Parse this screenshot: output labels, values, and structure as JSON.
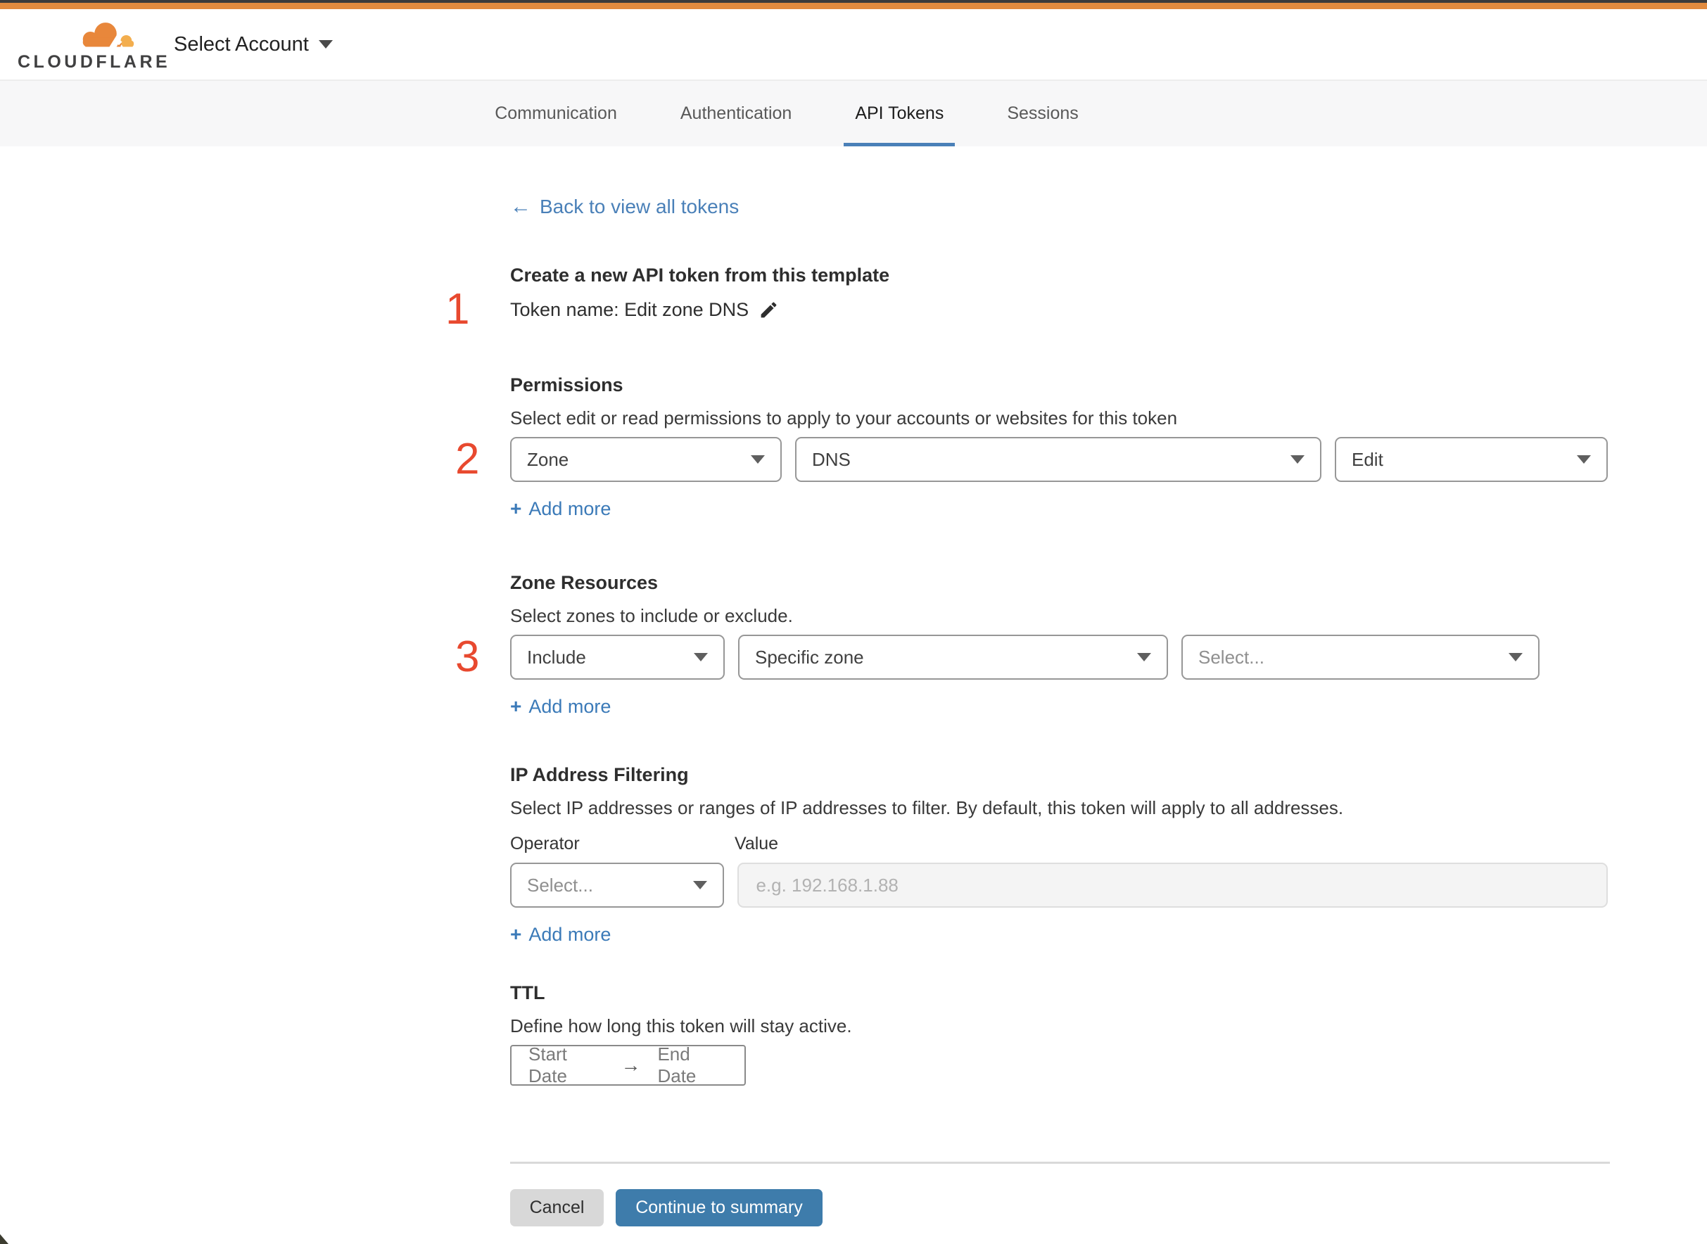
{
  "brand": {
    "logo_text": "CLOUDFLARE",
    "account_selector": "Select Account"
  },
  "tabs": {
    "items": [
      {
        "label": "Communication"
      },
      {
        "label": "Authentication"
      },
      {
        "label": "API Tokens"
      },
      {
        "label": "Sessions"
      }
    ],
    "active": "API Tokens"
  },
  "page": {
    "back_link": {
      "arrow": "←",
      "label": "Back to view all tokens"
    },
    "token": {
      "step": "1",
      "heading": "Create a new API token from this template",
      "name_line": "Token name: Edit zone DNS"
    },
    "permissions": {
      "step": "2",
      "heading": "Permissions",
      "description": "Select edit or read permissions to apply to your accounts or websites for this token",
      "scope_select": "Zone",
      "resource_select": "DNS",
      "access_select": "Edit"
    },
    "zone_resources": {
      "step": "3",
      "heading": "Zone Resources",
      "description": "Select zones to include or exclude.",
      "mode_select": "Include",
      "type_select": "Specific zone",
      "zone_select_placeholder": "Select..."
    },
    "ip_filtering": {
      "heading": "IP Address Filtering",
      "description": "Select IP addresses or ranges of IP addresses to filter. By default, this token will apply to all addresses.",
      "operator_label": "Operator",
      "value_label": "Value",
      "operator_select_placeholder": "Select...",
      "value_placeholder": "e.g. 192.168.1.88"
    },
    "ttl": {
      "heading": "TTL",
      "description": "Define how long this token will stay active.",
      "start_label": "Start Date",
      "arrow": "→",
      "end_label": "End Date"
    },
    "actions": {
      "plus": "+",
      "add_more": "Add more",
      "cancel": "Cancel",
      "continue": "Continue to summary"
    }
  },
  "colors": {
    "top_bar_orange": "#e18b3f",
    "top_bar_dark": "#3b3b3b",
    "step_number_red": "#e8492f",
    "link_blue": "#4a80b8",
    "active_tab_underline": "#4a80b8",
    "continue_button_blue": "#3e7cab",
    "logo_cloud_orange": "#e8873b",
    "logo_cloud_light": "#f3ae4e"
  }
}
